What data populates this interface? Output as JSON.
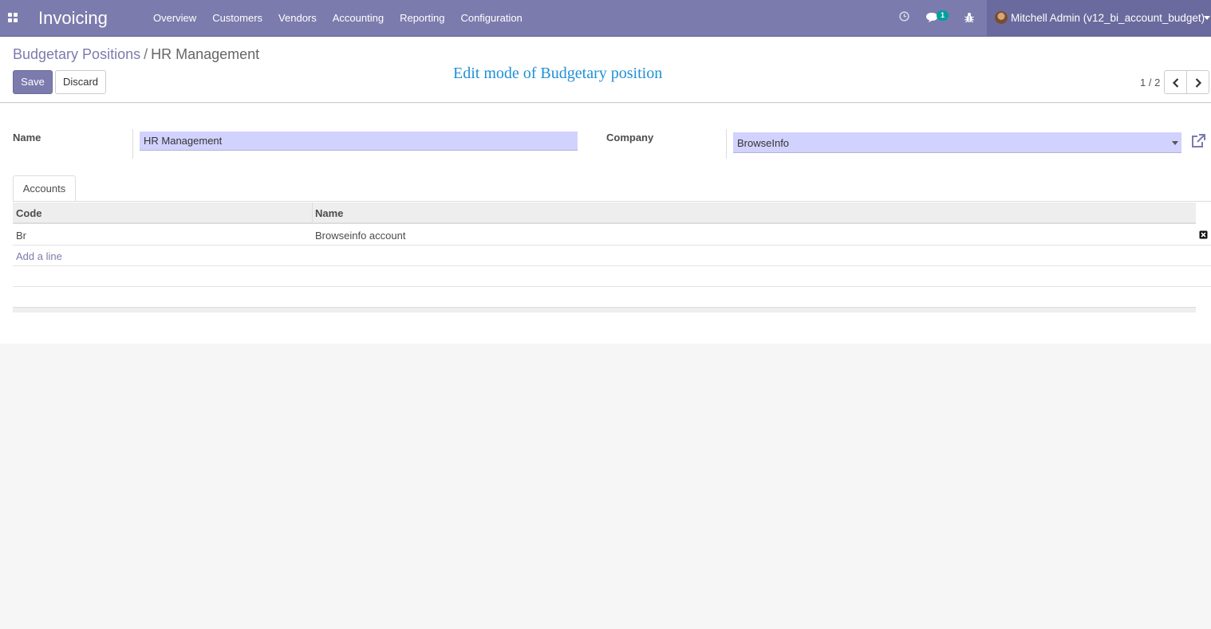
{
  "navbar": {
    "app_title": "Invoicing",
    "menu": [
      "Overview",
      "Customers",
      "Vendors",
      "Accounting",
      "Reporting",
      "Configuration"
    ],
    "messages_badge": "1",
    "user_name": "Mitchell Admin (v12_bi_account_budget)"
  },
  "breadcrumb": {
    "parent": "Budgetary Positions",
    "separator": "/",
    "current": "HR Management"
  },
  "actions": {
    "save_label": "Save",
    "discard_label": "Discard"
  },
  "annotation": "Edit mode of Budgetary position",
  "pager": {
    "value": "1 / 2"
  },
  "form": {
    "name_label": "Name",
    "name_value": "HR Management",
    "company_label": "Company",
    "company_value": "BrowseInfo"
  },
  "tabs": [
    "Accounts"
  ],
  "accounts_table": {
    "columns": [
      "Code",
      "Name"
    ],
    "rows": [
      {
        "code": "Br",
        "name": "Browseinfo account"
      }
    ],
    "add_line_label": "Add a line"
  },
  "colors": {
    "brand": "#7c7bad",
    "annotation": "#1e90d6",
    "editable_field_bg": "#d2d2ff"
  },
  "icons": {
    "apps": "apps-grid-icon",
    "activity": "clock-icon",
    "messages": "chat-icon",
    "debug": "bug-icon",
    "external": "external-link-icon",
    "delete": "trash-x-icon"
  }
}
